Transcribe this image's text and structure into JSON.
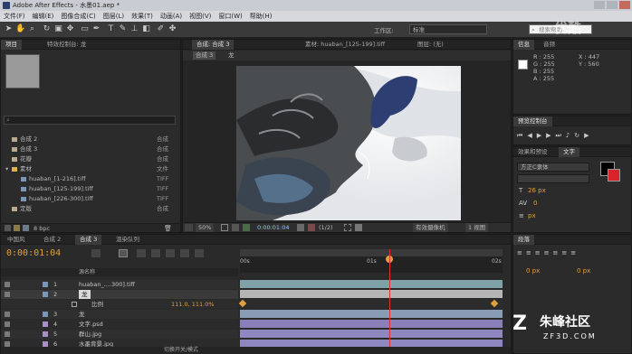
{
  "window": {
    "title": "Adobe After Effects - 水墨01.aep *"
  },
  "menu": [
    "文件(F)",
    "编辑(E)",
    "图像合成(C)",
    "图层(L)",
    "效果(T)",
    "动画(A)",
    "视图(V)",
    "窗口(W)",
    "帮助(H)"
  ],
  "toolbar": {
    "workspace_label": "工作区:",
    "workspace_value": "标准",
    "search_placeholder": "搜索帮助"
  },
  "project": {
    "tab": "项目",
    "tab2": "特效控制台: 龙",
    "bit_depth": "8 bpc",
    "items": [
      {
        "name": "合成 2",
        "type": "合成",
        "color": "#b9a98f"
      },
      {
        "name": "合成 3",
        "type": "合成",
        "color": "#b9a98f"
      },
      {
        "name": "花瓣",
        "type": "合成",
        "color": "#b9a98f"
      },
      {
        "name": "素材",
        "type": "文件",
        "color": "#e0b24a"
      },
      {
        "name": "huaban_[1-216].tiff",
        "type": "TIFF",
        "color": "#7a97b8"
      },
      {
        "name": "huaban_[125-199].tiff",
        "type": "TIFF",
        "color": "#7a97b8"
      },
      {
        "name": "huaban_[226-300].tiff",
        "type": "TIFF",
        "color": "#7a97b8"
      },
      {
        "name": "定版",
        "type": "合成",
        "color": "#b9a98f"
      }
    ]
  },
  "composition": {
    "tab": "合成: 合成 3",
    "footage_tab": "素材: huaban_[125-199].tiff",
    "layer_tab": "图层: (无)",
    "breadcrumb_comp": "合成 3",
    "breadcrumb_layer": "龙",
    "zoom": "50%",
    "timecode": "0:00:01:04",
    "resolution": "(1/2)",
    "camera": "有效摄像机",
    "views": "1 视图"
  },
  "info": {
    "tab": "信息",
    "tab2": "音频",
    "r": "R : 255",
    "g": "G : 255",
    "b": "B : 255",
    "a": "A : 255",
    "x": "X : 447",
    "y": "Y : 560"
  },
  "preview": {
    "tab": "预览控制台"
  },
  "effects": {
    "tab": "效果和预设",
    "tab2": "文字",
    "font": "方正C隶体",
    "size": "26 px",
    "tracking": "0",
    "leading": "px"
  },
  "paragraph": {
    "tab": "段落",
    "indent": "0 px"
  },
  "timeline": {
    "tabs": [
      "中国风",
      "合成 2",
      "合成 3",
      "渲染队列"
    ],
    "current_time": "0:00:01:04",
    "column_header": "源名称",
    "ruler": [
      "00s",
      "01s",
      "02s"
    ],
    "layers": [
      {
        "num": "1",
        "name": "huaban_....300].tiff",
        "color": "#7a97b8"
      },
      {
        "num": "2",
        "name": "龙",
        "color": "#7a97b8"
      },
      {
        "num": "",
        "name": "比例",
        "value": "111.0, 111.0%"
      },
      {
        "num": "3",
        "name": "龙",
        "color": "#7a97b8"
      },
      {
        "num": "4",
        "name": "文字.psd",
        "color": "#a98fc8"
      },
      {
        "num": "5",
        "name": "群山.jpg",
        "color": "#a98fc8"
      },
      {
        "num": "6",
        "name": "水墨背景.jpg",
        "color": "#a98fc8"
      }
    ],
    "footer": "切换开关/模式"
  },
  "watermarks": {
    "youku": "优酷",
    "site": "朱峰社区",
    "url": "ZF3D.COM"
  }
}
